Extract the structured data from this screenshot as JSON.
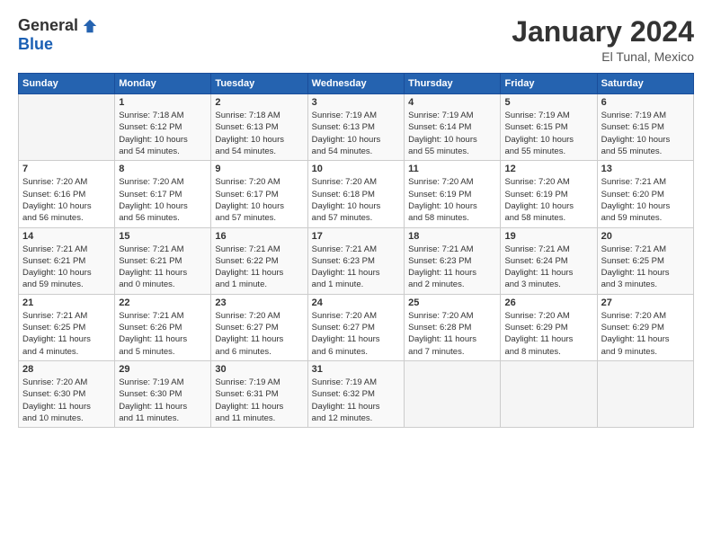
{
  "logo": {
    "general": "General",
    "blue": "Blue"
  },
  "header": {
    "month": "January 2024",
    "location": "El Tunal, Mexico"
  },
  "weekdays": [
    "Sunday",
    "Monday",
    "Tuesday",
    "Wednesday",
    "Thursday",
    "Friday",
    "Saturday"
  ],
  "weeks": [
    [
      {
        "day": "",
        "info": ""
      },
      {
        "day": "1",
        "info": "Sunrise: 7:18 AM\nSunset: 6:12 PM\nDaylight: 10 hours\nand 54 minutes."
      },
      {
        "day": "2",
        "info": "Sunrise: 7:18 AM\nSunset: 6:13 PM\nDaylight: 10 hours\nand 54 minutes."
      },
      {
        "day": "3",
        "info": "Sunrise: 7:19 AM\nSunset: 6:13 PM\nDaylight: 10 hours\nand 54 minutes."
      },
      {
        "day": "4",
        "info": "Sunrise: 7:19 AM\nSunset: 6:14 PM\nDaylight: 10 hours\nand 55 minutes."
      },
      {
        "day": "5",
        "info": "Sunrise: 7:19 AM\nSunset: 6:15 PM\nDaylight: 10 hours\nand 55 minutes."
      },
      {
        "day": "6",
        "info": "Sunrise: 7:19 AM\nSunset: 6:15 PM\nDaylight: 10 hours\nand 55 minutes."
      }
    ],
    [
      {
        "day": "7",
        "info": "Sunrise: 7:20 AM\nSunset: 6:16 PM\nDaylight: 10 hours\nand 56 minutes."
      },
      {
        "day": "8",
        "info": "Sunrise: 7:20 AM\nSunset: 6:17 PM\nDaylight: 10 hours\nand 56 minutes."
      },
      {
        "day": "9",
        "info": "Sunrise: 7:20 AM\nSunset: 6:17 PM\nDaylight: 10 hours\nand 57 minutes."
      },
      {
        "day": "10",
        "info": "Sunrise: 7:20 AM\nSunset: 6:18 PM\nDaylight: 10 hours\nand 57 minutes."
      },
      {
        "day": "11",
        "info": "Sunrise: 7:20 AM\nSunset: 6:19 PM\nDaylight: 10 hours\nand 58 minutes."
      },
      {
        "day": "12",
        "info": "Sunrise: 7:20 AM\nSunset: 6:19 PM\nDaylight: 10 hours\nand 58 minutes."
      },
      {
        "day": "13",
        "info": "Sunrise: 7:21 AM\nSunset: 6:20 PM\nDaylight: 10 hours\nand 59 minutes."
      }
    ],
    [
      {
        "day": "14",
        "info": "Sunrise: 7:21 AM\nSunset: 6:21 PM\nDaylight: 10 hours\nand 59 minutes."
      },
      {
        "day": "15",
        "info": "Sunrise: 7:21 AM\nSunset: 6:21 PM\nDaylight: 11 hours\nand 0 minutes."
      },
      {
        "day": "16",
        "info": "Sunrise: 7:21 AM\nSunset: 6:22 PM\nDaylight: 11 hours\nand 1 minute."
      },
      {
        "day": "17",
        "info": "Sunrise: 7:21 AM\nSunset: 6:23 PM\nDaylight: 11 hours\nand 1 minute."
      },
      {
        "day": "18",
        "info": "Sunrise: 7:21 AM\nSunset: 6:23 PM\nDaylight: 11 hours\nand 2 minutes."
      },
      {
        "day": "19",
        "info": "Sunrise: 7:21 AM\nSunset: 6:24 PM\nDaylight: 11 hours\nand 3 minutes."
      },
      {
        "day": "20",
        "info": "Sunrise: 7:21 AM\nSunset: 6:25 PM\nDaylight: 11 hours\nand 3 minutes."
      }
    ],
    [
      {
        "day": "21",
        "info": "Sunrise: 7:21 AM\nSunset: 6:25 PM\nDaylight: 11 hours\nand 4 minutes."
      },
      {
        "day": "22",
        "info": "Sunrise: 7:21 AM\nSunset: 6:26 PM\nDaylight: 11 hours\nand 5 minutes."
      },
      {
        "day": "23",
        "info": "Sunrise: 7:20 AM\nSunset: 6:27 PM\nDaylight: 11 hours\nand 6 minutes."
      },
      {
        "day": "24",
        "info": "Sunrise: 7:20 AM\nSunset: 6:27 PM\nDaylight: 11 hours\nand 6 minutes."
      },
      {
        "day": "25",
        "info": "Sunrise: 7:20 AM\nSunset: 6:28 PM\nDaylight: 11 hours\nand 7 minutes."
      },
      {
        "day": "26",
        "info": "Sunrise: 7:20 AM\nSunset: 6:29 PM\nDaylight: 11 hours\nand 8 minutes."
      },
      {
        "day": "27",
        "info": "Sunrise: 7:20 AM\nSunset: 6:29 PM\nDaylight: 11 hours\nand 9 minutes."
      }
    ],
    [
      {
        "day": "28",
        "info": "Sunrise: 7:20 AM\nSunset: 6:30 PM\nDaylight: 11 hours\nand 10 minutes."
      },
      {
        "day": "29",
        "info": "Sunrise: 7:19 AM\nSunset: 6:30 PM\nDaylight: 11 hours\nand 11 minutes."
      },
      {
        "day": "30",
        "info": "Sunrise: 7:19 AM\nSunset: 6:31 PM\nDaylight: 11 hours\nand 11 minutes."
      },
      {
        "day": "31",
        "info": "Sunrise: 7:19 AM\nSunset: 6:32 PM\nDaylight: 11 hours\nand 12 minutes."
      },
      {
        "day": "",
        "info": ""
      },
      {
        "day": "",
        "info": ""
      },
      {
        "day": "",
        "info": ""
      }
    ]
  ]
}
